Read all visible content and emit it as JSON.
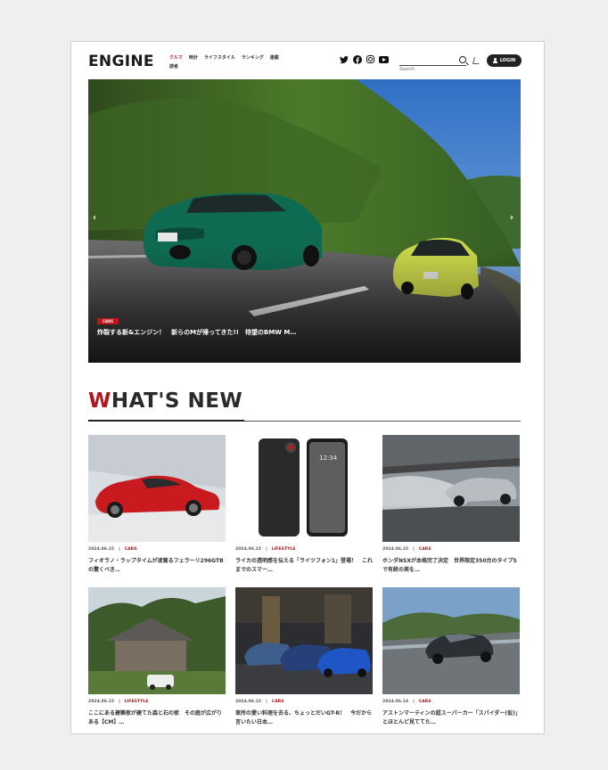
{
  "header": {
    "logo": "ENGINE",
    "nav": [
      "クルマ",
      "時計",
      "ライフスタイル",
      "ランキング",
      "連載",
      "読者"
    ],
    "search_placeholder": "Search",
    "login_label": "LOGIN"
  },
  "hero": {
    "badge": "CARS",
    "title": "炸裂する新&エンジン！　新らのMが帰ってきた!!　待望のBMW M…"
  },
  "section": {
    "title_first": "W",
    "title_rest": "HAT'S NEW"
  },
  "articles": [
    {
      "date": "2024.06.15",
      "category": "CARS",
      "title": "フィオラノ・ラップタイムが凌駕るフェラーリ296GTBの驚くべき…"
    },
    {
      "date": "2024.06.15",
      "category": "LIFESTYLE",
      "title": "ライカの透明感を伝える「ライツフォン1」登場！　これまでのスマー…"
    },
    {
      "date": "2024.06.15",
      "category": "CARS",
      "title": "ホンダNSXが本格完了決定　世界限定350台のタイプSで有終の美を…"
    },
    {
      "date": "2024.06.15",
      "category": "LIFESTYLE",
      "title": "ここにある建築家が建てた森と石の家　その庭が広がりある【CM】…"
    },
    {
      "date": "2024.06.15",
      "category": "CARS",
      "title": "車所の愛い料理を去る、ちょっとだいGT-R！　今だから言いたい日本…"
    },
    {
      "date": "2024.06.14",
      "category": "CARS",
      "title": "アストンマーティンの超スーパーカー「スパイダー(仮)」とほとんど見ててた…"
    }
  ],
  "colors": {
    "accent": "#b5161b",
    "text": "#222222",
    "page_bg": "#efefef"
  }
}
